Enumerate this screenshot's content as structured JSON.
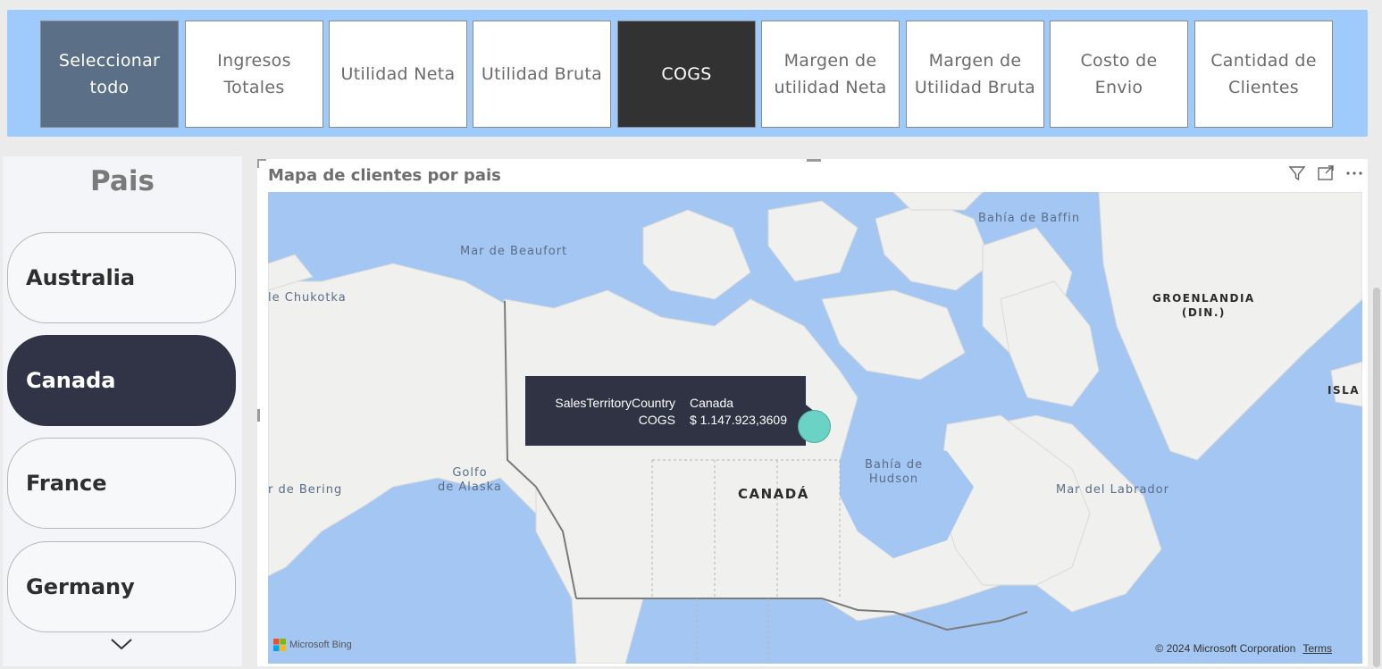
{
  "measures": {
    "buttons": [
      {
        "label": "Seleccionar todo",
        "state": "select-all"
      },
      {
        "label": "Ingresos Totales",
        "state": "normal"
      },
      {
        "label": "Utilidad Neta",
        "state": "normal"
      },
      {
        "label": "Utilidad Bruta",
        "state": "normal"
      },
      {
        "label": "COGS",
        "state": "active"
      },
      {
        "label": "Margen de utilidad Neta",
        "state": "normal"
      },
      {
        "label": "Margen de Utilidad Bruta",
        "state": "normal"
      },
      {
        "label": "Costo de Envio",
        "state": "normal"
      },
      {
        "label": "Cantidad de Clientes",
        "state": "normal"
      }
    ]
  },
  "country_slicer": {
    "title": "Pais",
    "items": [
      {
        "label": "Australia",
        "selected": false
      },
      {
        "label": "Canada",
        "selected": true
      },
      {
        "label": "France",
        "selected": false
      },
      {
        "label": "Germany",
        "selected": false
      }
    ]
  },
  "map_visual": {
    "title": "Mapa de clientes por pais",
    "labels": {
      "beaufort": "Mar de Beaufort",
      "baffin": "Bahía de Baffin",
      "chukotka": "le Chukotka",
      "groenlandia_1": "GROENLANDIA",
      "groenlandia_2": "(DIN.)",
      "isla": "ISLA",
      "golfo_1": "Golfo",
      "golfo_2": "de Alaska",
      "bering": "r de Bering",
      "hudson_1": "Bahía de",
      "hudson_2": "Hudson",
      "canada": "CANADÁ",
      "labrador": "Mar del Labrador"
    },
    "tooltip": {
      "country_key": "SalesTerritoryCountry",
      "country_value": "Canada",
      "measure_key": "COGS",
      "measure_value": "$ 1.147.923,3609"
    },
    "attribution": "Microsoft Bing",
    "copyright": "© 2024 Microsoft Corporation",
    "terms": "Terms"
  },
  "colors": {
    "slicer_bg": "#9ecbfb",
    "select_all": "#5b6f86",
    "active_button": "#323232",
    "selected_country": "#313346",
    "bubble": "#6bd3c6",
    "water": "#a4c6f2"
  }
}
